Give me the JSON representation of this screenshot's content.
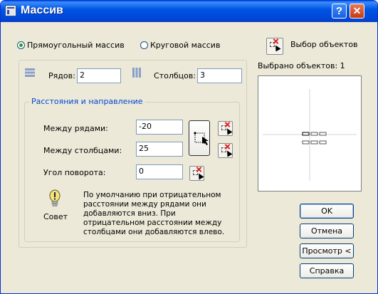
{
  "window": {
    "title": "Массив"
  },
  "mode": {
    "rect_label": "Прямоугольный массив",
    "polar_label": "Круговой массив",
    "selected": "rect"
  },
  "select_objects": {
    "label": "Выбор объектов",
    "selected_count_text": "Выбрано объектов: 1"
  },
  "grid": {
    "rows_label": "Рядов:",
    "rows_value": "2",
    "cols_label": "Столбцов:",
    "cols_value": "3"
  },
  "offsets": {
    "group_title": "Расстояния и направление",
    "row_label": "Между рядами:",
    "row_value": "-20",
    "col_label": "Между столбцами:",
    "col_value": "25",
    "angle_label": "Угол поворота:",
    "angle_value": "0"
  },
  "tip": {
    "label": "Совет",
    "text": "По умолчанию при отрицательном расстоянии между рядами они добавляются вниз. При отрицательном расстоянии между столбцами они добавляются влево."
  },
  "buttons": {
    "ok": "OK",
    "cancel": "Отмена",
    "preview": "Просмотр <",
    "help": "Справка"
  },
  "colors": {
    "title_bar": "#0055e5",
    "dialog_bg": "#ece9d8",
    "group_title": "#0046d5"
  }
}
